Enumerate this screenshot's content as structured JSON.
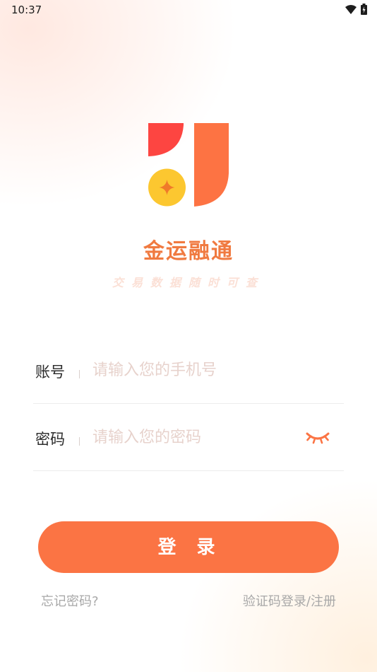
{
  "status_bar": {
    "time": "10:37",
    "icons": [
      "wifi-icon",
      "battery-icon"
    ]
  },
  "app": {
    "name": "金运融通",
    "slogan": "交易数据随时可查"
  },
  "login_form": {
    "account": {
      "label": "账号",
      "placeholder": "请输入您的手机号"
    },
    "password": {
      "label": "密码",
      "placeholder": "请输入您的密码",
      "toggle_icon": "eye-closed-icon"
    },
    "submit_label": "登 录"
  },
  "links": {
    "forgot_password": "忘记密码?",
    "sms_login_register": "验证码登录/注册"
  },
  "colors": {
    "accent": "#fb7444",
    "logo_red": "#fd4541",
    "logo_orange": "#fd7343",
    "logo_gold": "#fcc730"
  }
}
